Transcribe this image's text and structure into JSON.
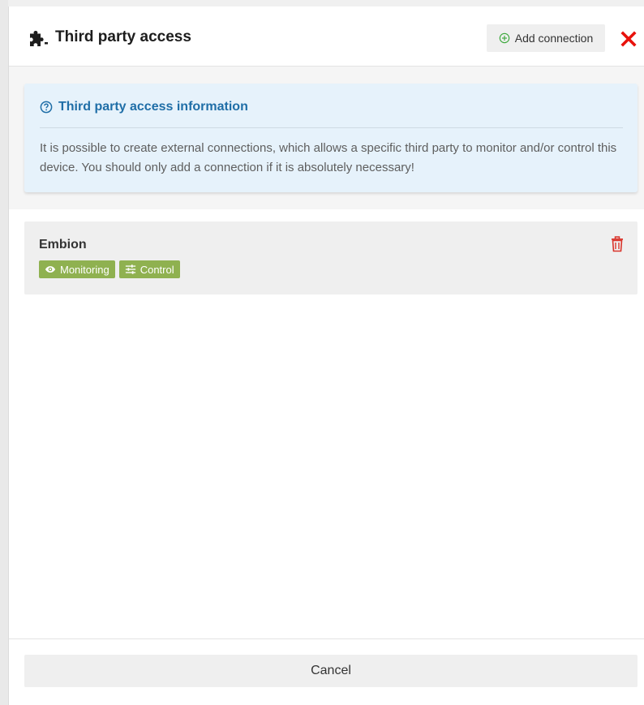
{
  "dialog": {
    "title": "Third party access",
    "add_connection_label": "Add connection"
  },
  "info": {
    "title": "Third party access information",
    "text": "It is possible to create external connections, which allows a specific third party to monitor and/or control this device. You should only add a connection if it is absolutely necessary!"
  },
  "connections": [
    {
      "name": "Embion",
      "badges": [
        {
          "label": "Monitoring",
          "icon": "eye-icon"
        },
        {
          "label": "Control",
          "icon": "sliders-icon"
        }
      ]
    }
  ],
  "footer": {
    "cancel_label": "Cancel"
  },
  "colors": {
    "accent_blue": "#1f6ea7",
    "info_bg": "#e6f2fb",
    "badge_green": "#8fb150",
    "close_red": "#e8120c",
    "trash_red": "#d9342b",
    "add_icon_green": "#3aa83a"
  }
}
